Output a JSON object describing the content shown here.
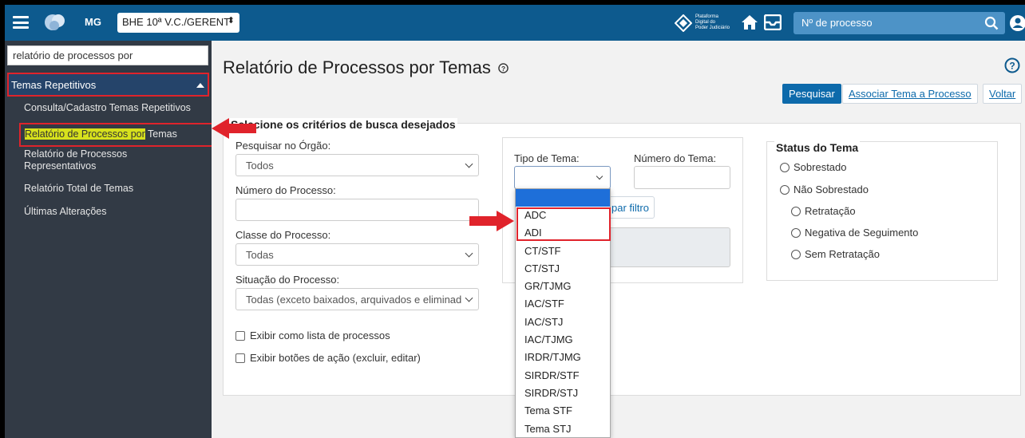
{
  "topbar": {
    "uf": "MG",
    "unit_select": "BHE 10ª V.C./GERENT",
    "platform_logo_text": [
      "Plataforma",
      "Digital do",
      "Poder Judiciário"
    ],
    "process_search_placeholder": "Nº de processo"
  },
  "sidebar": {
    "search_value": "relatório de processos por",
    "group_label": "Temas Repetitivos",
    "items": [
      {
        "label": "Consulta/Cadastro Temas Repetitivos"
      },
      {
        "label_highlight": "Relatório de Processos por",
        "label_rest": " Temas"
      },
      {
        "label_line1": "Relatório de Processos",
        "label_line2": "Representativos"
      },
      {
        "label": "Relatório Total de Temas"
      },
      {
        "label": "Últimas Alterações"
      }
    ]
  },
  "main": {
    "title": "Relatório de Processos por Temas",
    "buttons": {
      "search": "Pesquisar",
      "associate": "Associar Tema a Processo",
      "back": "Voltar"
    },
    "criteria_legend": "Selecione os critérios de busca desejados",
    "fields": {
      "orgao_label": "Pesquisar no Órgão:",
      "orgao_value": "Todos",
      "numero_label": "Número do Processo:",
      "classe_label": "Classe do Processo:",
      "classe_value": "Todas",
      "situacao_label": "Situação do Processo:",
      "situacao_value": "Todas (exceto baixados, arquivados e eliminad"
    },
    "checkboxes": [
      "Exibir como lista de processos",
      "Exibir botões de ação (excluir, editar)"
    ],
    "tema": {
      "tipo_label": "Tipo de Tema:",
      "numero_label": "Número do Tema:",
      "limpar_label": "par filtro"
    },
    "status": {
      "legend": "Status do Tema",
      "options": [
        "Sobrestado",
        "Não Sobrestado",
        "Retratação",
        "Negativa de Seguimento",
        "Sem Retratação"
      ]
    }
  },
  "dropdown": {
    "options": [
      "ADC",
      "ADI",
      "CT/STF",
      "CT/STJ",
      "GR/TJMG",
      "IAC/STF",
      "IAC/STJ",
      "IAC/TJMG",
      "IRDR/TJMG",
      "SIRDR/STF",
      "SIRDR/STJ",
      "Tema STF",
      "Tema STJ"
    ]
  },
  "colors": {
    "topbar": "#0d5a8e",
    "sidebar": "#323a45",
    "highlight": "#d7e11c",
    "annotation_red": "#e0232b",
    "primary": "#0d6aab"
  }
}
